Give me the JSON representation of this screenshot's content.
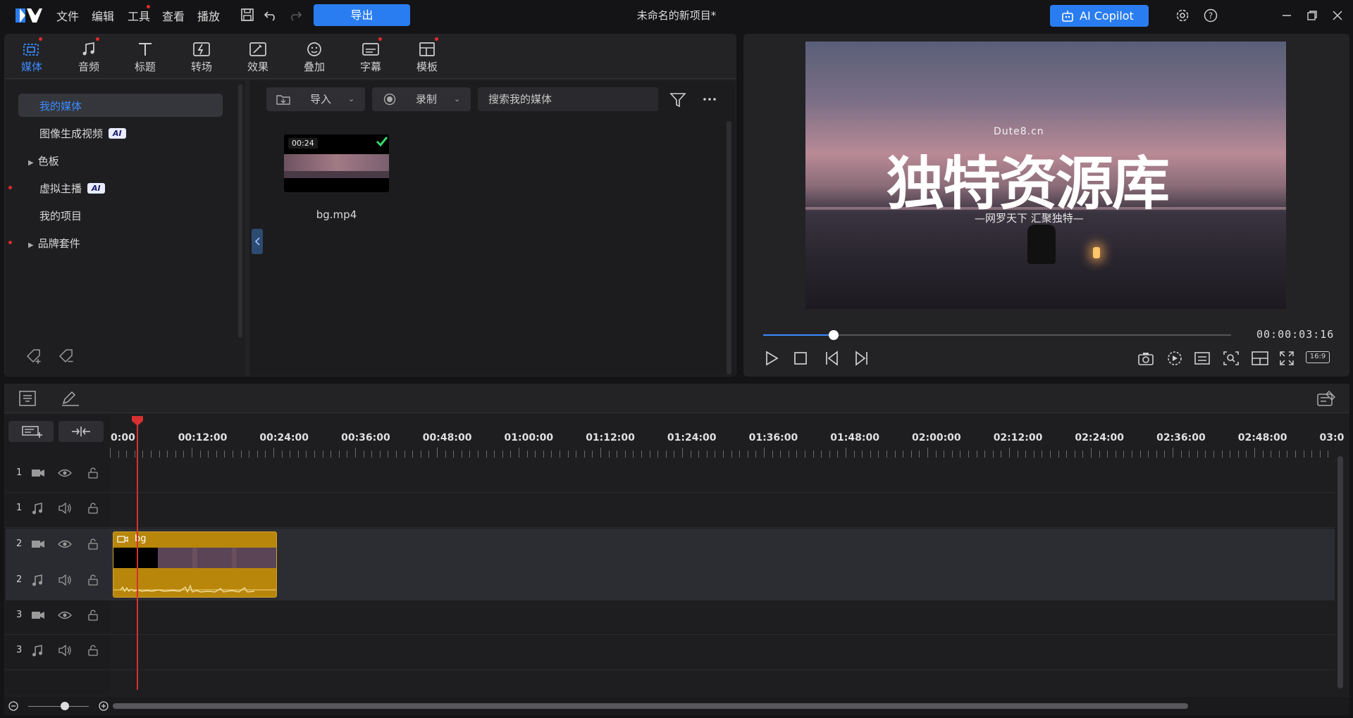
{
  "app": {
    "title": "未命名的新项目*",
    "menu": [
      "文件",
      "编辑",
      "工具",
      "查看",
      "播放"
    ],
    "export_label": "导出",
    "copilot_label": "AI Copilot",
    "accent": "#2a7df0"
  },
  "media_tabs": [
    {
      "label": "媒体",
      "icon": "media-icon",
      "active": true,
      "dot": true
    },
    {
      "label": "音频",
      "icon": "music-note-icon",
      "active": false,
      "dot": true
    },
    {
      "label": "标题",
      "icon": "title-t-icon",
      "active": false,
      "dot": false
    },
    {
      "label": "转场",
      "icon": "transition-icon",
      "active": false,
      "dot": false
    },
    {
      "label": "效果",
      "icon": "effect-icon",
      "active": false,
      "dot": false
    },
    {
      "label": "叠加",
      "icon": "sticker-icon",
      "active": false,
      "dot": false
    },
    {
      "label": "字幕",
      "icon": "subtitle-icon",
      "active": false,
      "dot": true
    },
    {
      "label": "模板",
      "icon": "template-icon",
      "active": false,
      "dot": true
    }
  ],
  "library": {
    "items": [
      {
        "label": "我的媒体",
        "selected": true,
        "ai": false,
        "expand": false,
        "dot": false
      },
      {
        "label": "图像生成视频",
        "selected": false,
        "ai": true,
        "expand": false,
        "dot": false
      },
      {
        "label": "色板",
        "selected": false,
        "ai": false,
        "expand": true,
        "dot": false
      },
      {
        "label": "虚拟主播",
        "selected": false,
        "ai": true,
        "expand": false,
        "dot": true
      },
      {
        "label": "我的项目",
        "selected": false,
        "ai": false,
        "expand": false,
        "dot": false
      },
      {
        "label": "品牌套件",
        "selected": false,
        "ai": false,
        "expand": true,
        "dot": true
      }
    ],
    "ai_badge": "AI"
  },
  "media_toolbar": {
    "import_label": "导入",
    "record_label": "录制",
    "search_placeholder": "搜索我的媒体"
  },
  "media_clip": {
    "duration": "00:24",
    "filename": "bg.mp4",
    "checked": true
  },
  "preview": {
    "watermark_site": "Dute8.cn",
    "watermark_title": "独特资源库",
    "watermark_sub": "—网罗天下  汇聚独特—",
    "timecode": "00:00:03:16",
    "progress": 0.15,
    "aspect": "16:9"
  },
  "timeline": {
    "ruler": [
      "0:00",
      "00:12:00",
      "00:24:00",
      "00:36:00",
      "00:48:00",
      "01:00:00",
      "01:12:00",
      "01:24:00",
      "01:36:00",
      "01:48:00",
      "02:00:00",
      "02:12:00",
      "02:24:00",
      "02:36:00",
      "02:48:00",
      "03:0"
    ],
    "tracks": [
      {
        "num": "1",
        "kind": "video"
      },
      {
        "num": "1",
        "kind": "audio"
      },
      {
        "num": "2",
        "kind": "video"
      },
      {
        "num": "2",
        "kind": "audio"
      },
      {
        "num": "3",
        "kind": "video"
      },
      {
        "num": "3",
        "kind": "audio"
      }
    ],
    "clip_label": "bg",
    "clip_color": "#b8860b"
  }
}
